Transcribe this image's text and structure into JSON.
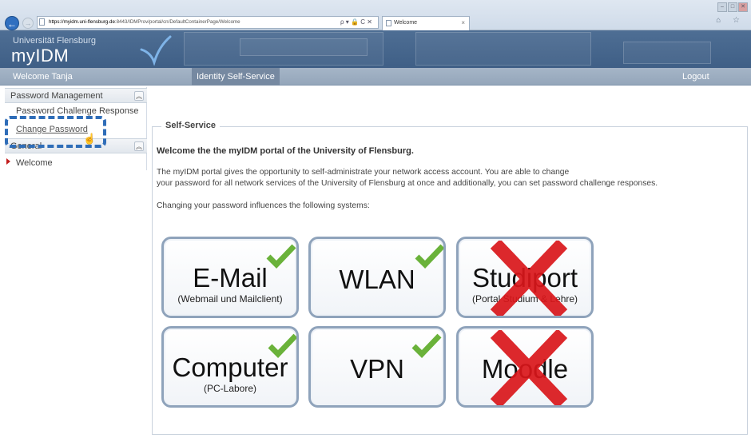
{
  "browser": {
    "url_domain": "https://myidm.uni-flensburg.de",
    "url_rest": ":8443/IDMProv/portal/cn/DefaultContainerPage/Welcome",
    "address_tools": "ρ ▾ 🔒 C ✕",
    "tab_title": "Welcome",
    "tab_close": "×",
    "back": "←",
    "forward": "→",
    "win_min": "–",
    "win_max": "□",
    "win_close": "✕",
    "home_star": "⌂ ☆"
  },
  "header": {
    "university": "Universität Flensburg",
    "app_name": "myIDM"
  },
  "nav": {
    "welcome_user": "Welcome Tanja",
    "active_tab": "Identity Self-Service",
    "logout": "Logout"
  },
  "sidebar": {
    "sections": [
      {
        "title": "Password Management",
        "collapse_icon": "︽",
        "items": [
          {
            "label": "Password Challenge Response"
          },
          {
            "label": "Change Password"
          }
        ]
      },
      {
        "title": "General",
        "collapse_icon": "︽",
        "items": [
          {
            "label": "Welcome"
          }
        ]
      }
    ]
  },
  "cursor": "☝",
  "main": {
    "legend": "Self-Service",
    "heading": "Welcome the the myIDM portal of the University of Flensburg.",
    "paragraph_line1": "The myIDM portal gives the opportunity to self-administrate your network access account. You are able to change",
    "paragraph_line2": "your password for all network services of the University of Flensburg at once and additionally, you can set password challenge responses.",
    "systems_intro": "Changing your password influences the following systems:",
    "tiles": [
      {
        "title": "E-Mail",
        "subtitle": "(Webmail und Mailclient)",
        "status": "check"
      },
      {
        "title": "WLAN",
        "subtitle": "",
        "status": "check"
      },
      {
        "title": "Studiport",
        "subtitle": "(Portal Studium & Lehre)",
        "status": "cross"
      },
      {
        "title": "Computer",
        "subtitle": "(PC-Labore)",
        "status": "check"
      },
      {
        "title": "VPN",
        "subtitle": "",
        "status": "check"
      },
      {
        "title": "Moodle",
        "subtitle": "",
        "status": "cross"
      }
    ]
  },
  "colors": {
    "header_bg": "#45668d",
    "nav_bg": "#9aabbe",
    "check_green": "#6ab23a",
    "cross_red": "#d9161b",
    "highlight_blue": "#2f6db8"
  }
}
